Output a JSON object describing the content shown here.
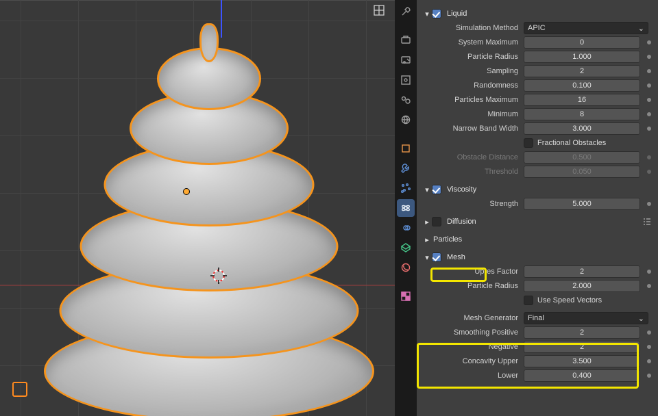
{
  "panel": {
    "liquid": {
      "title": "Liquid",
      "checked": true
    },
    "simulation_method": {
      "label": "Simulation Method",
      "value": "APIC"
    },
    "system_maximum": {
      "label": "System Maximum",
      "value": "0"
    },
    "particle_radius": {
      "label": "Particle Radius",
      "value": "1.000"
    },
    "sampling": {
      "label": "Sampling",
      "value": "2"
    },
    "randomness": {
      "label": "Randomness",
      "value": "0.100"
    },
    "particles_maximum": {
      "label": "Particles Maximum",
      "value": "16"
    },
    "minimum": {
      "label": "Minimum",
      "value": "8"
    },
    "narrow_band_width": {
      "label": "Narrow Band Width",
      "value": "3.000"
    },
    "fractional_obstacles": {
      "label": "Fractional Obstacles",
      "checked": false
    },
    "obstacle_distance": {
      "label": "Obstacle Distance",
      "value": "0.500"
    },
    "threshold": {
      "label": "Threshold",
      "value": "0.050"
    },
    "viscosity": {
      "title": "Viscosity",
      "checked": true
    },
    "strength": {
      "label": "Strength",
      "value": "5.000"
    },
    "diffusion": {
      "title": "Diffusion",
      "checked": false
    },
    "particles_section": {
      "title": "Particles"
    },
    "mesh": {
      "title": "Mesh",
      "checked": true
    },
    "upres_factor": {
      "label": "Upres Factor",
      "value": "2"
    },
    "mesh_particle_radius": {
      "label": "Particle Radius",
      "value": "2.000"
    },
    "use_speed_vectors": {
      "label": "Use Speed Vectors",
      "checked": false
    },
    "mesh_generator": {
      "label": "Mesh Generator",
      "value": "Final"
    },
    "smoothing_positive": {
      "label": "Smoothing Positive",
      "value": "2"
    },
    "smoothing_negative": {
      "label": "Negative",
      "value": "2"
    },
    "concavity_upper": {
      "label": "Concavity Upper",
      "value": "3.500"
    },
    "concavity_lower": {
      "label": "Lower",
      "value": "0.400"
    }
  },
  "tabs": [
    "tool",
    "render",
    "output",
    "viewlayer",
    "scene",
    "world",
    "object",
    "modifier",
    "particle",
    "physics",
    "constraint",
    "mesh-data",
    "material",
    "texture"
  ],
  "chart_data": null
}
